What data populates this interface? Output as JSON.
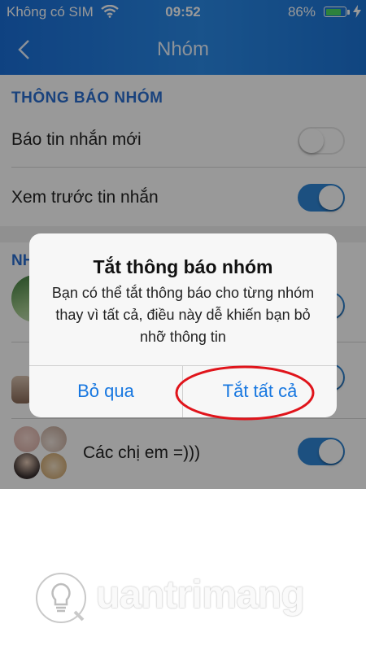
{
  "status_bar": {
    "carrier": "Không có SIM",
    "time": "09:52",
    "battery": "86%",
    "battery_level": 0.86
  },
  "nav": {
    "title": "Nhóm"
  },
  "settings": {
    "section_title": "THÔNG BÁO NHÓM",
    "rows": [
      {
        "label": "Báo tin nhắn mới",
        "on": false
      },
      {
        "label": "Xem trước tin nhắn",
        "on": true
      }
    ]
  },
  "groups": {
    "section_title_partial": "NH",
    "items": [
      {
        "name": "Các chị em =)))",
        "on": true
      }
    ]
  },
  "dialog": {
    "title": "Tắt thông báo nhóm",
    "message": "Bạn có thể tắt thông báo cho từng nhóm thay vì tất cả, điều này dễ khiến bạn bỏ nhỡ thông tin",
    "cancel_label": "Bỏ qua",
    "confirm_label": "Tắt tất cả"
  },
  "watermark": {
    "text": "uantrimang"
  },
  "colors": {
    "accent": "#2f86d6",
    "section": "#2a6fd1",
    "dialog_button": "#1777e0",
    "annotation": "#e0141b"
  }
}
